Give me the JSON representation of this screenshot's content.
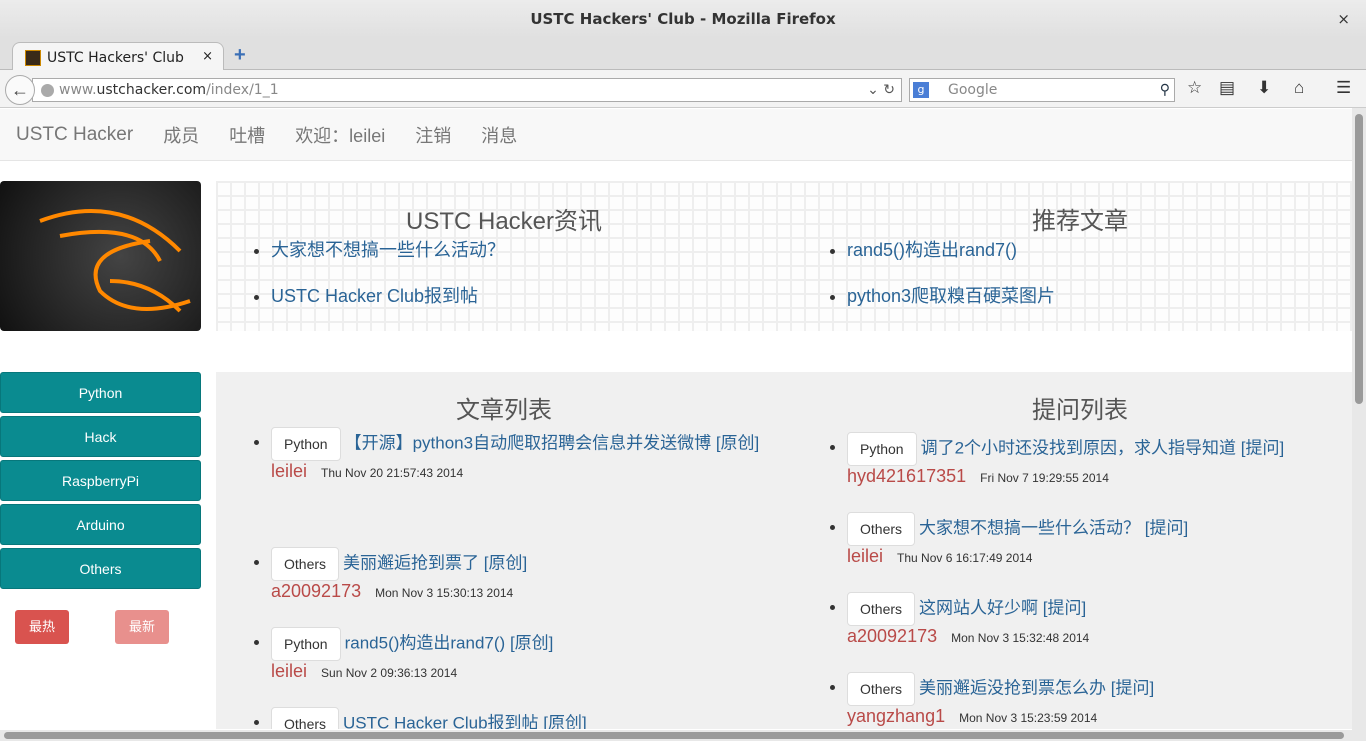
{
  "window": {
    "title": "USTC Hackers' Club - Mozilla Firefox",
    "close": "×"
  },
  "tab": {
    "title": "USTC Hackers' Club",
    "close": "×",
    "new": "+"
  },
  "url": {
    "prefix": "www.",
    "domain": "ustchacker.com",
    "path": "/index/1_1"
  },
  "search": {
    "placeholder": "Google",
    "engine": "g"
  },
  "nav": {
    "brand": "USTC Hacker",
    "items": [
      "成员",
      "吐槽",
      "欢迎：leilei",
      "注销",
      "消息"
    ]
  },
  "news": {
    "title": "USTC Hacker资讯",
    "items": [
      "大家想不想搞一些什么活动？",
      "USTC Hacker Club报到帖"
    ]
  },
  "recommend": {
    "title": "推荐文章",
    "items": [
      "rand5()构造出rand7()",
      "python3爬取糗百硬菜图片"
    ]
  },
  "categories": [
    "Python",
    "Hack",
    "RaspberryPi",
    "Arduino",
    "Others"
  ],
  "sort": {
    "hot": "最热",
    "new": "最新"
  },
  "articles": {
    "title": "文章列表",
    "items": [
      {
        "tag": "Python",
        "title": "【开源】python3自动爬取招聘会信息并发送微博",
        "suffix": "[原创]",
        "user": "leilei",
        "time": "Thu Nov 20 21:57:43 2014"
      },
      {
        "tag": "Others",
        "title": "美丽邂逅抢到票了",
        "suffix": "[原创]",
        "user": "a20092173",
        "time": "Mon Nov 3 15:30:13 2014"
      },
      {
        "tag": "Python",
        "title": "rand5()构造出rand7()",
        "suffix": "[原创]",
        "user": "leilei",
        "time": "Sun Nov 2 09:36:13 2014"
      },
      {
        "tag": "Others",
        "title": "USTC Hacker Club报到帖",
        "suffix": "[原创]",
        "user": "",
        "time": ""
      }
    ]
  },
  "questions": {
    "title": "提问列表",
    "items": [
      {
        "tag": "Python",
        "title": "调了2个小时还没找到原因，求人指导知道",
        "suffix": "[提问]",
        "user": "hyd421617351",
        "time": "Fri Nov 7 19:29:55 2014"
      },
      {
        "tag": "Others",
        "title": "大家想不想搞一些什么活动？",
        "suffix": "[提问]",
        "user": "leilei",
        "time": "Thu Nov 6 16:17:49 2014"
      },
      {
        "tag": "Others",
        "title": "这网站人好少啊",
        "suffix": "[提问]",
        "user": "a20092173",
        "time": "Mon Nov 3 15:32:48 2014"
      },
      {
        "tag": "Others",
        "title": "美丽邂逅没抢到票怎么办",
        "suffix": "[提问]",
        "user": "yangzhang1",
        "time": "Mon Nov 3 15:23:59 2014"
      }
    ]
  },
  "colors": {
    "accent": "#0a8b90",
    "user": "#b94a48",
    "link": "#2a6496"
  }
}
